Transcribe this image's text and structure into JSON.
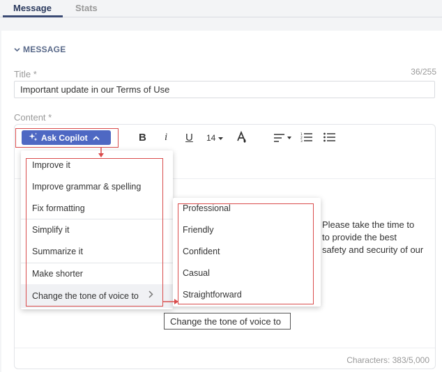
{
  "tabs": [
    {
      "label": "Message"
    },
    {
      "label": "Stats"
    }
  ],
  "section": {
    "title": "MESSAGE"
  },
  "title_field": {
    "label": "Title *",
    "counter": "36/255",
    "value": "Important update in our Terms of Use"
  },
  "content_field": {
    "label": "Content *",
    "character_count": "Characters: 383/5,000"
  },
  "toolbar": {
    "copilot_label": "Ask Copilot",
    "font_size": "14"
  },
  "body_text": [
    "Please take the time to",
    "to provide the best",
    "safety and security of our"
  ],
  "copilot_menu": {
    "items": [
      {
        "label": "Improve it"
      },
      {
        "label": "Improve grammar & spelling"
      },
      {
        "label": "Fix formatting"
      },
      {
        "label": "Simplify it"
      },
      {
        "label": "Summarize it"
      },
      {
        "label": "Make shorter"
      },
      {
        "label": "Change the tone of voice to"
      }
    ]
  },
  "tone_menu": {
    "items": [
      {
        "label": "Professional"
      },
      {
        "label": "Friendly"
      },
      {
        "label": "Confident"
      },
      {
        "label": "Casual"
      },
      {
        "label": "Straightforward"
      }
    ]
  },
  "tooltip": {
    "text": "Change the tone of voice to"
  },
  "colors": {
    "accent": "#4e68c3",
    "annotation": "#d94b4b"
  }
}
